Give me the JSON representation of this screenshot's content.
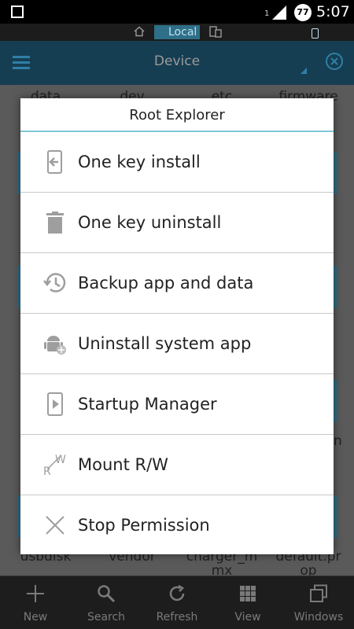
{
  "status_bar": {
    "sim_label": "1",
    "badge": "77",
    "time": "5:07"
  },
  "location_bar": {
    "local_label": "Local"
  },
  "header": {
    "title": "Device"
  },
  "background_files": {
    "top_row": [
      "data",
      "dev",
      "etc",
      "firmware"
    ],
    "bottom_row": [
      "usbdisk",
      "vendor",
      "charger_m\nmx",
      "default.pr\nop"
    ],
    "side_fragment": "n"
  },
  "dialog": {
    "title": "Root Explorer",
    "items": [
      {
        "label": "One key install",
        "icon": "install-icon"
      },
      {
        "label": "One key uninstall",
        "icon": "trash-icon"
      },
      {
        "label": "Backup app and data",
        "icon": "history-icon"
      },
      {
        "label": "Uninstall system app",
        "icon": "android-icon"
      },
      {
        "label": "Startup Manager",
        "icon": "play-phone-icon"
      },
      {
        "label": "Mount R/W",
        "icon": "rw-icon"
      },
      {
        "label": "Stop Permission",
        "icon": "close-x-icon"
      }
    ]
  },
  "bottom_nav": {
    "items": [
      {
        "label": "New",
        "icon": "plus-icon"
      },
      {
        "label": "Search",
        "icon": "search-icon"
      },
      {
        "label": "Refresh",
        "icon": "refresh-icon"
      },
      {
        "label": "View",
        "icon": "grid-icon"
      },
      {
        "label": "Windows",
        "icon": "windows-icon"
      }
    ]
  },
  "colors": {
    "header_bg": "#163e52",
    "accent": "#2f7fa6",
    "dialog_divider": "#7ec8d9",
    "icon_gray": "#9e9e9e"
  }
}
